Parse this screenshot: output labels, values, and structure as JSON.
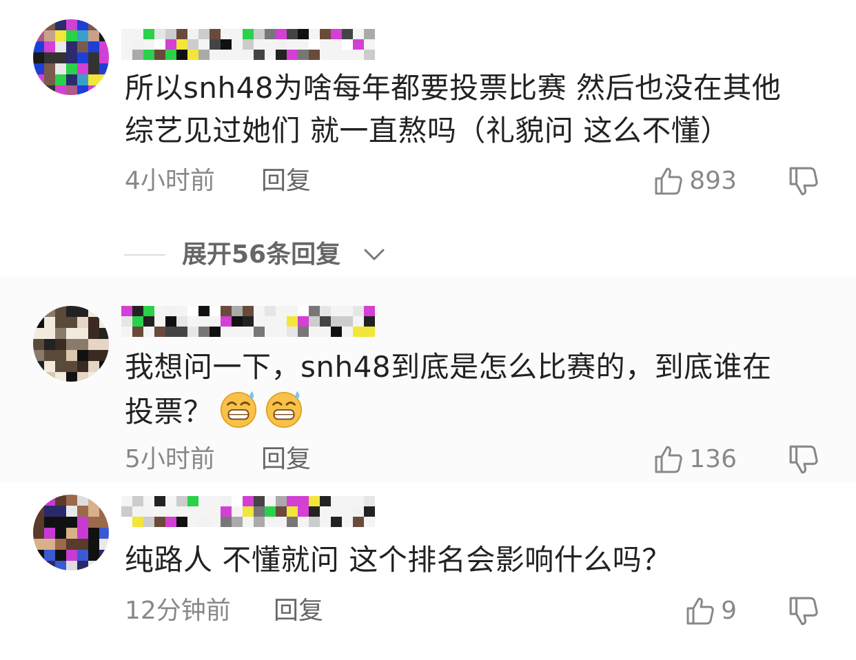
{
  "comments": [
    {
      "text": "所以snh48为啥每年都要投票比赛 然后也没在其他综艺见过她们 就一直熬吗（礼貌问 这么不懂）",
      "line1": "所以snh48为啥每年都要投票比赛 然后也没在其他",
      "line2": "综艺见过她们 就一直熬吗（礼貌问 这么不懂）",
      "time": "4小时前",
      "reply_label": "回复",
      "likes": "893"
    },
    {
      "line1": "我想问一下，snh48到底是怎么比赛的，到底谁在",
      "line2": "投票？",
      "emojis": [
        "grin-sweat-emoji",
        "grin-sweat-emoji"
      ],
      "time": "5小时前",
      "reply_label": "回复",
      "likes": "136"
    },
    {
      "line1": "纯路人 不懂就问 这个排名会影响什么吗？",
      "time": "12分钟前",
      "reply_label": "回复",
      "likes": "9"
    }
  ],
  "expand_replies": {
    "label": "展开56条回复"
  },
  "colors": {
    "text": "#222222",
    "meta": "#888888",
    "background": "#ffffff"
  }
}
